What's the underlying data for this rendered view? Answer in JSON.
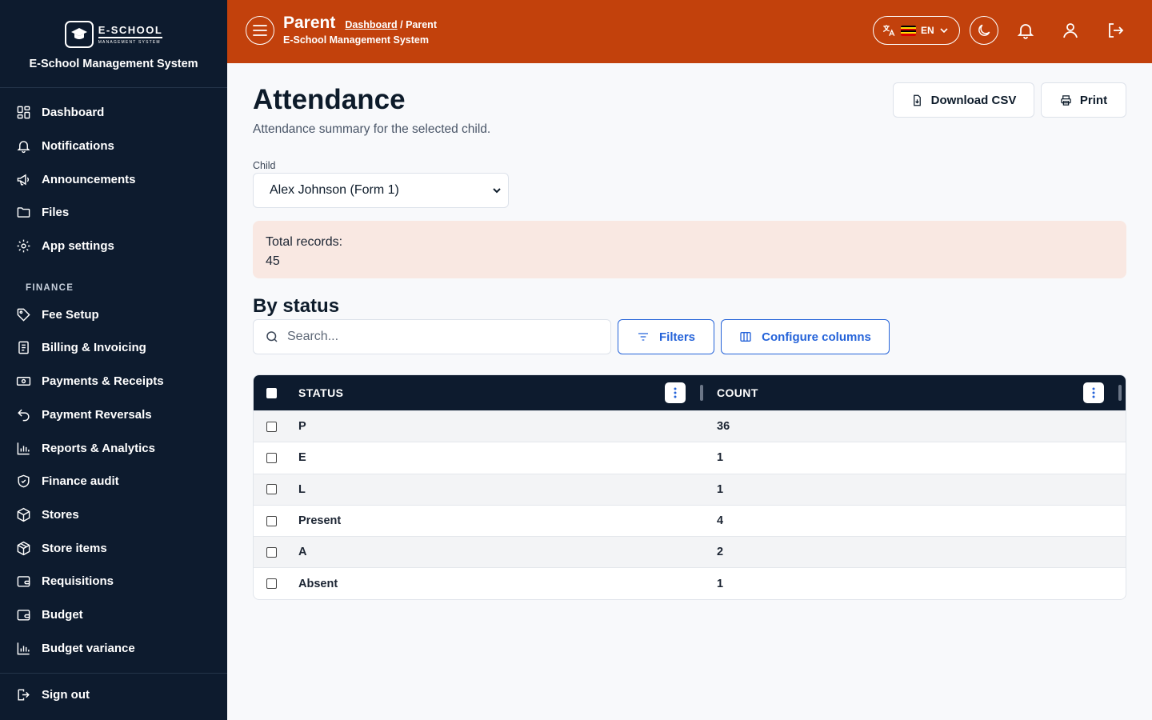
{
  "brand": {
    "logo_main": "E-SCHOOL",
    "logo_sub": "MANAGEMENT SYSTEM",
    "app_name": "E-School Management System"
  },
  "sidebar": {
    "items": [
      {
        "label": "Dashboard",
        "icon": "dashboard-icon"
      },
      {
        "label": "Notifications",
        "icon": "bell-icon"
      },
      {
        "label": "Announcements",
        "icon": "megaphone-icon"
      },
      {
        "label": "Files",
        "icon": "folder-icon"
      },
      {
        "label": "App settings",
        "icon": "gear-icon"
      }
    ],
    "finance_section": "FINANCE",
    "finance_items": [
      {
        "label": "Fee Setup",
        "icon": "tag-icon"
      },
      {
        "label": "Billing & Invoicing",
        "icon": "invoice-icon"
      },
      {
        "label": "Payments & Receipts",
        "icon": "banknote-icon"
      },
      {
        "label": "Payment Reversals",
        "icon": "undo-icon"
      },
      {
        "label": "Reports & Analytics",
        "icon": "bar-chart-icon"
      },
      {
        "label": "Finance audit",
        "icon": "shield-check-icon"
      },
      {
        "label": "Stores",
        "icon": "box-icon"
      },
      {
        "label": "Store items",
        "icon": "package-icon"
      },
      {
        "label": "Requisitions",
        "icon": "wallet-icon"
      },
      {
        "label": "Budget",
        "icon": "wallet-icon"
      },
      {
        "label": "Budget variance",
        "icon": "bar-chart-icon"
      }
    ],
    "sign_out": "Sign out"
  },
  "header": {
    "role": "Parent",
    "breadcrumb_link": "Dashboard",
    "breadcrumb_sep": " / ",
    "breadcrumb_current": "Parent",
    "subtitle": "E-School Management System",
    "language": "EN",
    "flag_colors": [
      "#000000",
      "#fcdc04",
      "#d90000"
    ]
  },
  "page": {
    "title": "Attendance",
    "subtitle": "Attendance summary for the selected child.",
    "download_csv": "Download CSV",
    "print": "Print",
    "child_label": "Child",
    "child_selected": "Alex Johnson (Form 1)",
    "total_label": "Total records:",
    "total_value": "45",
    "section_title": "By status",
    "search_placeholder": "Search...",
    "filters": "Filters",
    "configure_columns": "Configure columns"
  },
  "table": {
    "headers": [
      "STATUS",
      "COUNT"
    ],
    "rows": [
      {
        "status": "P",
        "count": "36"
      },
      {
        "status": "E",
        "count": "1"
      },
      {
        "status": "L",
        "count": "1"
      },
      {
        "status": "Present",
        "count": "4"
      },
      {
        "status": "A",
        "count": "2"
      },
      {
        "status": "Absent",
        "count": "1"
      }
    ]
  },
  "colors": {
    "sidebar_bg": "#0d1b2e",
    "header_bg": "#c2410c",
    "accent_blue": "#2563d9",
    "summary_bg": "#f9e8e2"
  }
}
